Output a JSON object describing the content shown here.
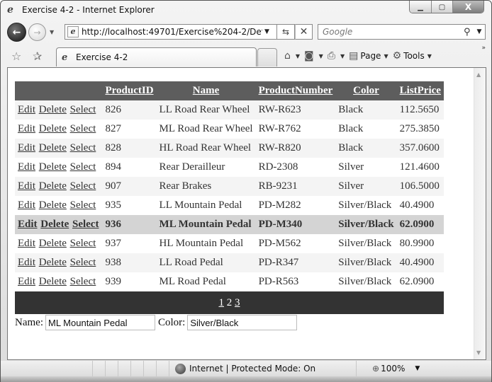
{
  "window": {
    "title": "Exercise 4-2 - Internet Explorer",
    "controls": {
      "minimize": "▁",
      "maximize": "▢",
      "close": "X"
    }
  },
  "nav": {
    "url": "http://localhost:49701/Exercise%204-2/Default.aspx",
    "search_placeholder": "Google",
    "back_glyph": "←",
    "forward_glyph": "→",
    "refresh_glyph": "⇆",
    "stop_glyph": "✕",
    "search_glyph": "⚲",
    "dropdown_glyph": "▼"
  },
  "tabs": {
    "active_label": "Exercise 4-2",
    "favorites_glyph": "☆",
    "add_favorites_glyph": "✰"
  },
  "command_bar": {
    "home_glyph": "⌂",
    "feeds_glyph": "◙",
    "print_glyph": "⎙",
    "page_glyph": "▤",
    "page_label": "Page",
    "tools_glyph": "⚙",
    "tools_label": "Tools",
    "more_glyph": "»"
  },
  "grid": {
    "columns": [
      "",
      "ProductID",
      "Name",
      "ProductNumber",
      "Color",
      "ListPrice"
    ],
    "command_labels": {
      "edit": "Edit",
      "delete": "Delete",
      "select": "Select"
    },
    "selected_index": 6,
    "rows": [
      {
        "id": "826",
        "name": "LL Road Rear Wheel",
        "number": "RW-R623",
        "color": "Black",
        "price": "112.5650"
      },
      {
        "id": "827",
        "name": "ML Road Rear Wheel",
        "number": "RW-R762",
        "color": "Black",
        "price": "275.3850"
      },
      {
        "id": "828",
        "name": "HL Road Rear Wheel",
        "number": "RW-R820",
        "color": "Black",
        "price": "357.0600"
      },
      {
        "id": "894",
        "name": "Rear Derailleur",
        "number": "RD-2308",
        "color": "Silver",
        "price": "121.4600"
      },
      {
        "id": "907",
        "name": "Rear Brakes",
        "number": "RB-9231",
        "color": "Silver",
        "price": "106.5000"
      },
      {
        "id": "935",
        "name": "LL Mountain Pedal",
        "number": "PD-M282",
        "color": "Silver/Black",
        "price": "40.4900"
      },
      {
        "id": "936",
        "name": "ML Mountain Pedal",
        "number": "PD-M340",
        "color": "Silver/Black",
        "price": "62.0900"
      },
      {
        "id": "937",
        "name": "HL Mountain Pedal",
        "number": "PD-M562",
        "color": "Silver/Black",
        "price": "80.9900"
      },
      {
        "id": "938",
        "name": "LL Road Pedal",
        "number": "PD-R347",
        "color": "Silver/Black",
        "price": "40.4900"
      },
      {
        "id": "939",
        "name": "ML Road Pedal",
        "number": "PD-R563",
        "color": "Silver/Black",
        "price": "62.0900"
      }
    ],
    "pager": {
      "pages": [
        "1",
        "2",
        "3"
      ],
      "current": "2"
    }
  },
  "form": {
    "name_label": "Name:",
    "name_value": "ML Mountain Pedal",
    "color_label": "Color:",
    "color_value": "Silver/Black"
  },
  "status": {
    "zone_text": "Internet | Protected Mode: On",
    "zoom_text": "100%",
    "zoom_glyph": "⊕"
  }
}
